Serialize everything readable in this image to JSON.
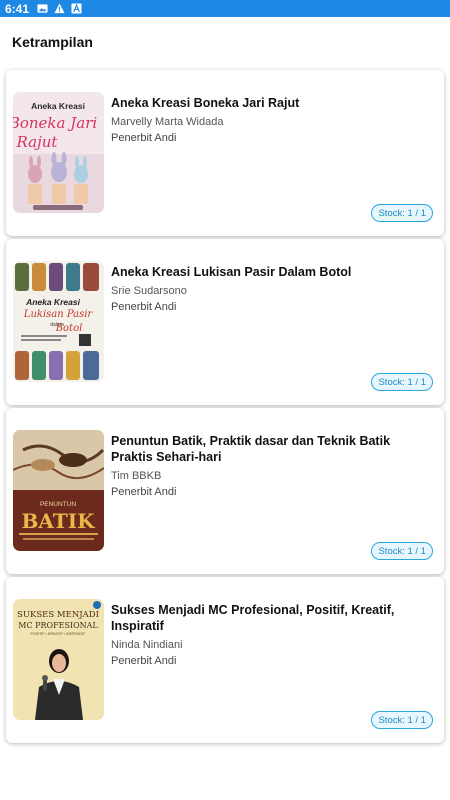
{
  "status_bar": {
    "time": "6:41",
    "icons": [
      "image-icon",
      "warning-icon",
      "app-icon"
    ]
  },
  "app_bar": {
    "title": "Ketrampilan"
  },
  "books": [
    {
      "title": "Aneka Kreasi Boneka Jari Rajut",
      "author": "Marvelly Marta Widada",
      "publisher": "Penerbit Andi",
      "stock": "Stock: 1 / 1",
      "cover_lines": [
        "Aneka Kreasi",
        "Boneka Jari",
        "Rajut"
      ]
    },
    {
      "title": "Aneka Kreasi Lukisan Pasir Dalam Botol",
      "author": "Srie Sudarsono",
      "publisher": "Penerbit Andi",
      "stock": "Stock: 1 / 1",
      "cover_lines": [
        "Aneka Kreasi",
        "Lukisan Pasir",
        "dalam",
        "Botol"
      ]
    },
    {
      "title": "Penuntun Batik, Praktik dasar dan Teknik Batik Praktis Sehari-hari",
      "author": "Tim BBKB",
      "publisher": "Penerbit Andi",
      "stock": "Stock: 1 / 1",
      "cover_lines": [
        "PENUNTUN",
        "BATIK"
      ]
    },
    {
      "title": "Sukses Menjadi MC Profesional, Positif, Kreatif, Inspiratif",
      "author": "Ninda Nindiani",
      "publisher": "Penerbit Andi",
      "stock": "Stock: 1 / 1",
      "cover_lines": [
        "SUKSES MENJADI",
        "MC PROFESIONAL",
        "POSITIF • KREATIF • INSPIRATIF"
      ]
    }
  ]
}
